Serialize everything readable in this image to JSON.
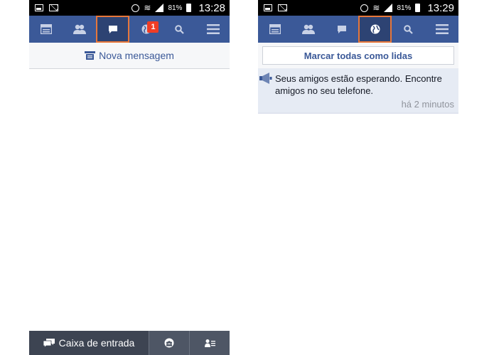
{
  "left": {
    "status": {
      "battery": "81%",
      "time": "13:28"
    },
    "nav": {
      "notifications_badge": "1"
    },
    "compose_label": "Nova mensagem",
    "bottom": {
      "inbox_label": "Caixa de entrada"
    }
  },
  "right": {
    "status": {
      "battery": "81%",
      "time": "13:29"
    },
    "mark_read_label": "Marcar todas como lidas",
    "notification": {
      "text": "Seus amigos estão esperando. Encontre amigos no seu telefone.",
      "time": "há 2 minutos"
    }
  },
  "colors": {
    "brand": "#3b5998",
    "active_tab": "#2d4373",
    "highlight_outline": "#e8773a",
    "badge": "#f03d25",
    "bottom_bar": "#4e5665"
  },
  "icons": [
    "image-icon",
    "mail-icon",
    "alarm-icon",
    "wifi-icon",
    "signal-icon",
    "battery-icon",
    "news-feed-icon",
    "friends-icon",
    "messages-icon",
    "globe-icon",
    "search-icon",
    "menu-icon",
    "compose-icon",
    "megaphone-icon",
    "group-icon",
    "contacts-icon"
  ]
}
